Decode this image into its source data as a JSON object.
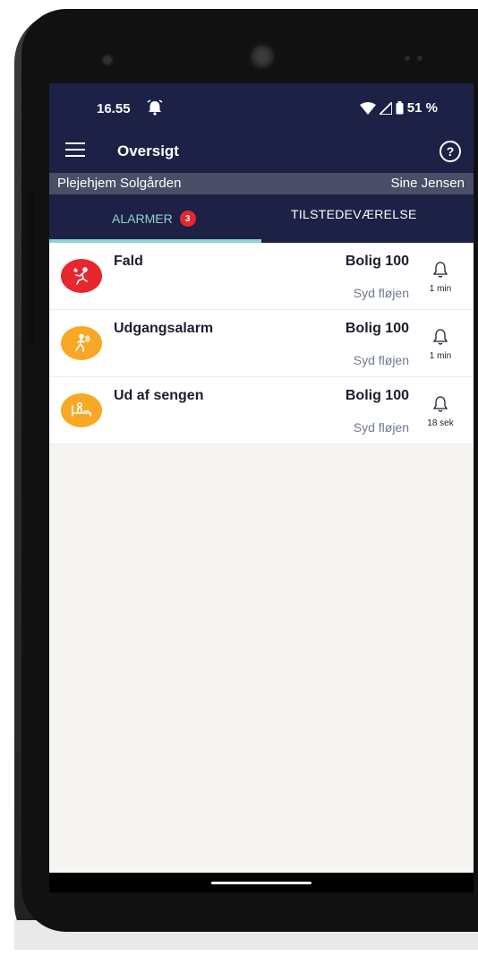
{
  "status_bar": {
    "time": "16.55",
    "battery": "51 %"
  },
  "app_bar": {
    "title": "Oversigt",
    "help_label": "?"
  },
  "info_bar": {
    "facility": "Plejehjem Solgården",
    "user": "Sine Jensen"
  },
  "tabs": [
    {
      "label": "ALARMER",
      "badge": "3",
      "selected": true
    },
    {
      "label": "TILSTEDEVÆRELSE",
      "selected": false
    }
  ],
  "alarms": [
    {
      "title": "Fald",
      "room": "Bolig 100",
      "wing": "Syd fløjen",
      "elapsed": "1 min",
      "color": "#e8262e",
      "icon": "fall-person-icon"
    },
    {
      "title": "Udgangsalarm",
      "room": "Bolig 100",
      "wing": "Syd fløjen",
      "elapsed": "1 min",
      "color": "#f9a825",
      "icon": "walking-person-icon"
    },
    {
      "title": "Ud af sengen",
      "room": "Bolig 100",
      "wing": "Syd fløjen",
      "elapsed": "18 sek",
      "color": "#f9a825",
      "icon": "bed-exit-icon"
    }
  ],
  "colors": {
    "header_bg": "#1d2145",
    "info_bar_bg": "#4a4e66",
    "accent_teal": "#8fd3cf",
    "badge_red": "#e8262e",
    "screen_bg": "#f6f5f2"
  }
}
